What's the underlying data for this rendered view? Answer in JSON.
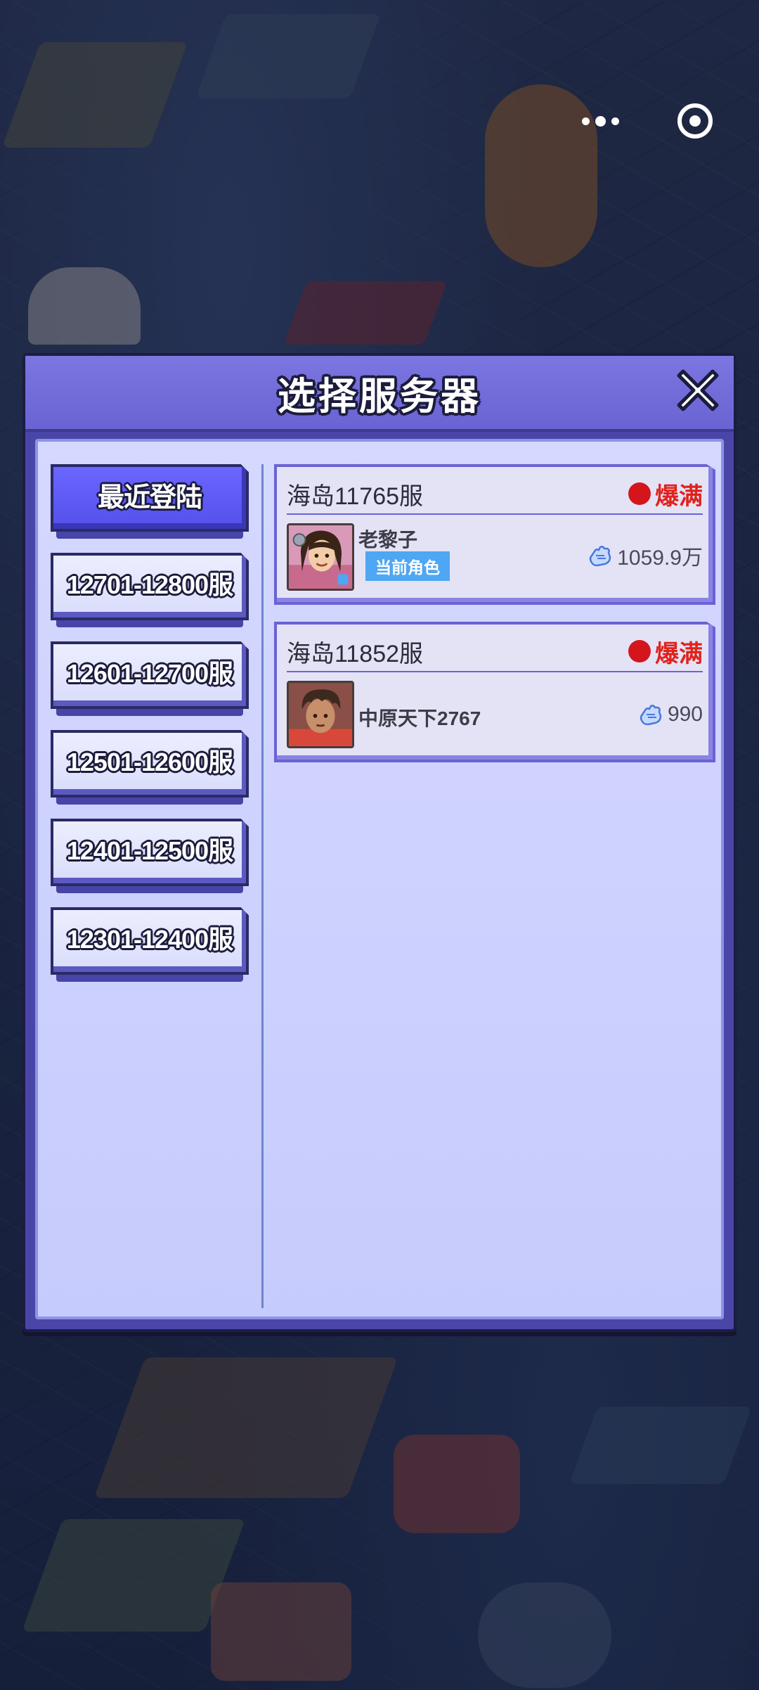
{
  "capsule": {
    "more_icon": "more-dots-icon",
    "close_icon": "target-circle-icon"
  },
  "dialog": {
    "title": "选择服务器",
    "close_icon": "close-x-icon",
    "nav": [
      {
        "label": "最近登陆",
        "active": true
      },
      {
        "label": "12701-12800服",
        "active": false
      },
      {
        "label": "12601-12700服",
        "active": false
      },
      {
        "label": "12501-12600服",
        "active": false
      },
      {
        "label": "12401-12500服",
        "active": false
      },
      {
        "label": "12301-12400服",
        "active": false
      }
    ],
    "servers": [
      {
        "name": "海岛11765服",
        "status": "爆满",
        "status_color": "#d5151c",
        "role_name": "老黎子",
        "badge": "当前角色",
        "power": "1059.9万",
        "power_icon": "fist-icon"
      },
      {
        "name": "海岛11852服",
        "status": "爆满",
        "status_color": "#d5151c",
        "role_name": "中原天下2767",
        "power": "990",
        "power_icon": "fist-icon"
      }
    ]
  }
}
